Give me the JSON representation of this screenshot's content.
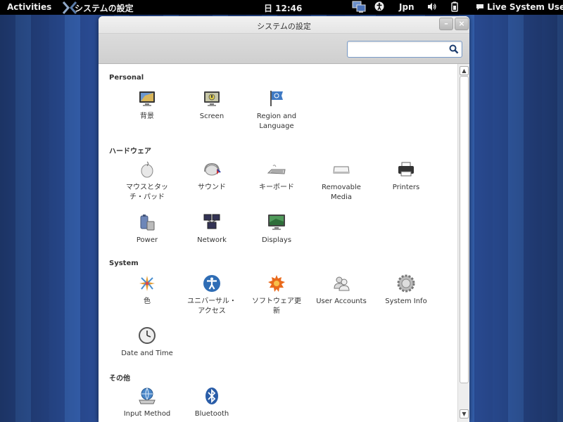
{
  "topbar": {
    "activities": "Activities",
    "app_name": "システムの設定",
    "clock": "日 12:46",
    "keyboard": "Jpn",
    "user": "Live System User"
  },
  "window": {
    "title": "システムの設定",
    "minimize": "–",
    "close": "×",
    "search_placeholder": ""
  },
  "sections": {
    "personal": {
      "title": "Personal",
      "items": [
        {
          "label": "背景",
          "icon": "background-icon"
        },
        {
          "label": "Screen",
          "icon": "screen-icon"
        },
        {
          "label": "Region and\nLanguage",
          "icon": "region-flag-icon"
        }
      ]
    },
    "hardware": {
      "title": "ハードウェア",
      "items": [
        {
          "label": "マウスとタッ\nチ・パッド",
          "icon": "mouse-icon"
        },
        {
          "label": "サウンド",
          "icon": "sound-icon"
        },
        {
          "label": "キーボード",
          "icon": "keyboard-icon"
        },
        {
          "label": "Removable\nMedia",
          "icon": "removable-media-icon"
        },
        {
          "label": "Printers",
          "icon": "printer-icon"
        },
        {
          "label": "Power",
          "icon": "power-icon"
        },
        {
          "label": "Network",
          "icon": "network-icon"
        },
        {
          "label": "Displays",
          "icon": "displays-icon"
        }
      ]
    },
    "system": {
      "title": "System",
      "items": [
        {
          "label": "色",
          "icon": "color-icon"
        },
        {
          "label": "ユニバーサル・\nアクセス",
          "icon": "universal-access-icon"
        },
        {
          "label": "ソフトウェア更\n新",
          "icon": "software-update-icon"
        },
        {
          "label": "User Accounts",
          "icon": "user-accounts-icon"
        },
        {
          "label": "System Info",
          "icon": "system-info-icon"
        },
        {
          "label": "Date and Time",
          "icon": "clock-icon"
        }
      ]
    },
    "other": {
      "title": "その他",
      "items": [
        {
          "label": "Input Method",
          "icon": "input-method-icon"
        },
        {
          "label": "Bluetooth",
          "icon": "bluetooth-icon"
        }
      ]
    }
  }
}
